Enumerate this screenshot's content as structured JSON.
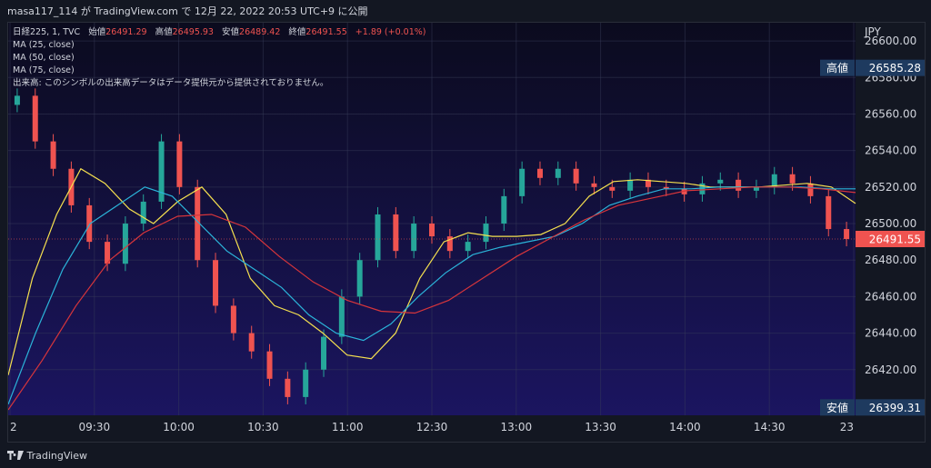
{
  "header": {
    "publisher": "masa117_114 が TradingView.com で 12月 22, 2022 20:53 UTC+9 に公開"
  },
  "legend": {
    "symbol": "日経225, 1, TVC",
    "open_label": "始値",
    "open_value": "26491.29",
    "high_label": "高値",
    "high_value": "26495.93",
    "low_label": "安値",
    "low_value": "26489.42",
    "close_label": "終値",
    "close_value": "26491.55",
    "change": "+1.89 (+0.01%)",
    "ma25": "MA (25, close)",
    "ma50": "MA (50, close)",
    "ma75": "MA (75, close)",
    "volume_note": "出来高: このシンボルの出来高データはデータ提供元から提供されておりません。"
  },
  "footer": {
    "brand": "TradingView"
  },
  "colors": {
    "background_top": "#0b0b1e",
    "background_bottom": "#1b1560",
    "up": "#26a69a",
    "down": "#ef5350",
    "ma25": "#f5e04f",
    "ma50": "#2bb4d9",
    "ma75": "#d7353b",
    "axis_text": "#d1d4dc",
    "hl_badge": "#1e3a5f",
    "last_badge": "#ef5350"
  },
  "chart_data": {
    "type": "line",
    "currency": "JPY",
    "ylim": [
      26395,
      26610
    ],
    "y_ticks": [
      26600,
      26580,
      26560,
      26540,
      26520,
      26500,
      26480,
      26460,
      26440,
      26420
    ],
    "x_ticks": [
      "2",
      "09:30",
      "10:00",
      "10:30",
      "11:00",
      "12:30",
      "13:00",
      "13:30",
      "14:00",
      "14:30",
      "23"
    ],
    "badges": {
      "high": {
        "label": "高値",
        "value": 26585.28
      },
      "low": {
        "label": "安値",
        "value": 26399.31
      },
      "last": {
        "value": 26491.55
      }
    },
    "series": [
      {
        "name": "MA (25, close)",
        "values": [
          26417,
          26470,
          26505,
          26530,
          26522,
          26508,
          26500,
          26512,
          26520,
          26505,
          26470,
          26455,
          26450,
          26440,
          26428,
          26426,
          26440,
          26470,
          26490,
          26495,
          26493,
          26493,
          26494,
          26500,
          26515,
          26523,
          26524,
          26523,
          26522,
          26520,
          26520,
          26520,
          26521,
          26522,
          26520,
          26511
        ]
      },
      {
        "name": "MA (50, close)",
        "values": [
          26401,
          26440,
          26475,
          26500,
          26510,
          26520,
          26515,
          26500,
          26485,
          26475,
          26465,
          26450,
          26440,
          26436,
          26445,
          26460,
          26473,
          26483,
          26487,
          26490,
          26493,
          26500,
          26510,
          26515,
          26519,
          26519,
          26520,
          26520,
          26520,
          26520,
          26519,
          26519
        ]
      },
      {
        "name": "MA (75, close)",
        "values": [
          26398,
          26425,
          26455,
          26480,
          26495,
          26504,
          26505,
          26498,
          26482,
          26468,
          26458,
          26452,
          26451,
          26458,
          26470,
          26482,
          26492,
          26502,
          26510,
          26514,
          26518,
          26519,
          26520,
          26520,
          26519,
          26517
        ]
      },
      {
        "name": "close",
        "values": [
          26570,
          26545,
          26530,
          26510,
          26490,
          26478,
          26500,
          26512,
          26545,
          26520,
          26480,
          26455,
          26440,
          26430,
          26415,
          26405,
          26420,
          26438,
          26460,
          26480,
          26505,
          26485,
          26500,
          26493,
          26485,
          26490,
          26500,
          26515,
          26530,
          26525,
          26530,
          26522,
          26520,
          26518,
          26524,
          26520,
          26519,
          26516,
          26522,
          26524,
          26518,
          26520,
          26527,
          26522,
          26515,
          26497,
          26491.55
        ]
      }
    ]
  }
}
